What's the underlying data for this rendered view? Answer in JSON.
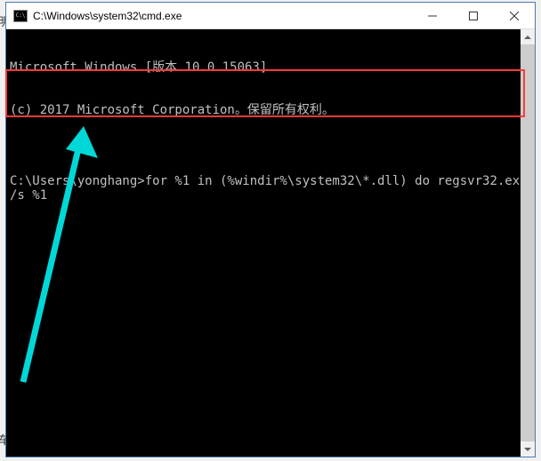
{
  "window": {
    "title": "C:\\Windows\\system32\\cmd.exe"
  },
  "terminal": {
    "line1": "Microsoft Windows [版本 10.0.15063]",
    "line2": "(c) 2017 Microsoft Corporation。保留所有权利。",
    "blank": "",
    "prompt_line": "C:\\Users\\yonghang>for %1 in (%windir%\\system32\\*.dll) do regsvr32.exe /s %1"
  },
  "annotations": {
    "highlight_color": "#ff3a3a",
    "arrow_color": "#00d8d8"
  },
  "left_edge": {
    "char1": "明",
    "char2": "车"
  }
}
